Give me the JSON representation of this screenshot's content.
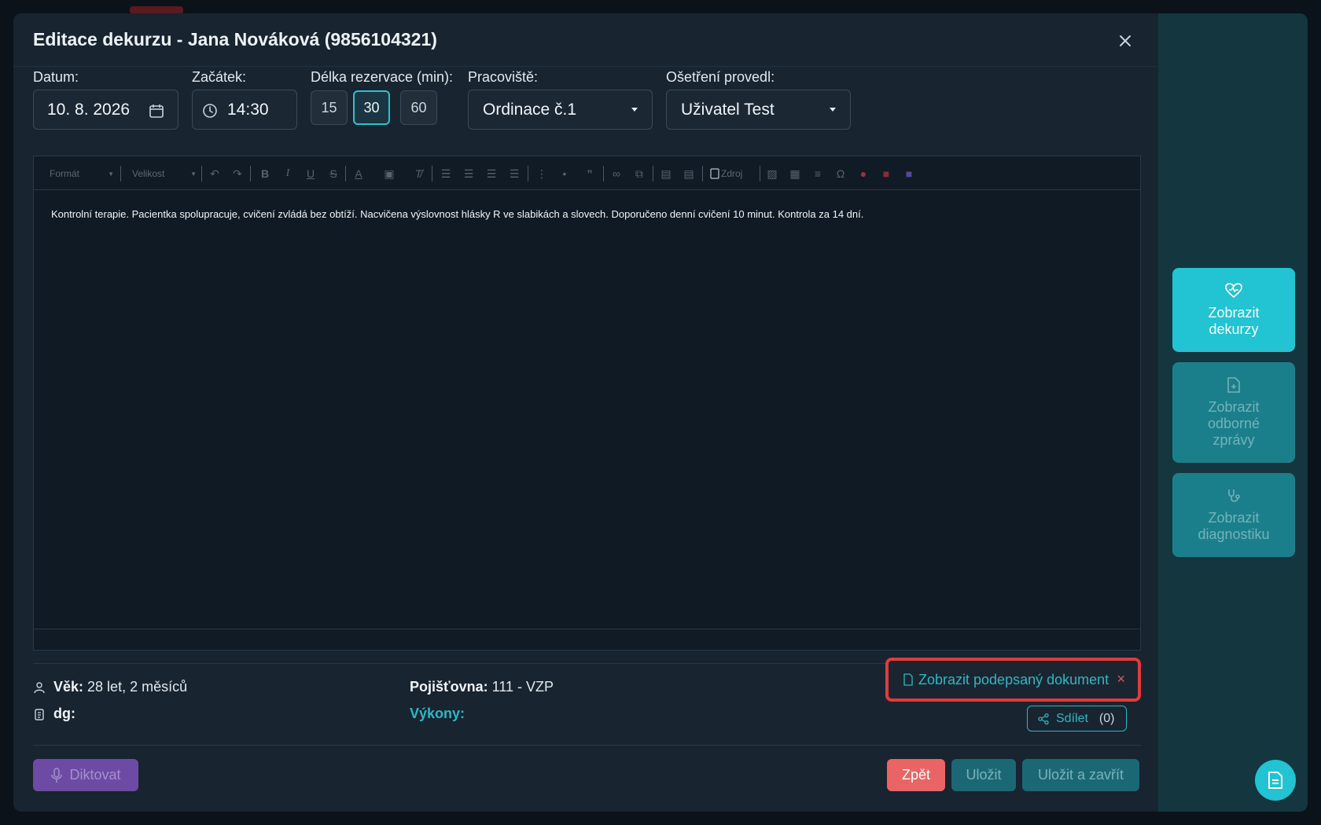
{
  "dialog": {
    "title": "Editace dekurzu - Jana Nováková (9856104321)"
  },
  "form": {
    "date_label": "Datum:",
    "date_value": "10. 8. 2026",
    "start_label": "Začátek:",
    "start_value": "14:30",
    "duration_label": "Délka rezervace (min):",
    "durations": [
      "15",
      "30",
      "60"
    ],
    "duration_selected": "30",
    "workplace_label": "Pracoviště:",
    "workplace_value": "Ordinace č.1",
    "performer_label": "Ošetření provedl:",
    "performer_value": "Uživatel Test"
  },
  "editor": {
    "toolbar": {
      "format_label": "Formát",
      "size_label": "Velikost",
      "source_label": "Zdroj"
    },
    "content": "Kontrolní terapie. Pacientka spolupracuje, cvičení zvládá bez obtíží. Nacvičena výslovnost hlásky R ve slabikách a slovech. Doporučeno denní cvičení 10 minut. Kontrola za 14 dní."
  },
  "patient_info": {
    "age_label": "Věk:",
    "age_value": "28 let, 2 měsíců",
    "dg_label": "dg:",
    "insurer_label": "Pojišťovna:",
    "insurer_value": "111 - VZP",
    "vykony_label": "Výkony:"
  },
  "signed_document": {
    "label": "Zobrazit podepsaný dokument",
    "close_symbol": "×"
  },
  "share": {
    "label": "Sdílet",
    "count": "(0)"
  },
  "actions": {
    "dictate": "Diktovat",
    "back": "Zpět",
    "save": "Uložit",
    "save_close": "Uložit a zavřít"
  },
  "side_panel": {
    "cards": [
      {
        "line1": "Zobrazit",
        "line2": "dekurzy",
        "line3": "",
        "icon": "heart-pulse-icon",
        "active": true
      },
      {
        "line1": "Zobrazit",
        "line2": "odborné",
        "line3": "zprávy",
        "icon": "document-plus-icon",
        "active": false
      },
      {
        "line1": "Zobrazit",
        "line2": "diagnostiku",
        "line3": "",
        "icon": "stethoscope-icon",
        "active": false
      }
    ]
  },
  "colors": {
    "accent": "#22c3d2",
    "danger": "#e96565",
    "highlight_border": "#e23b3b",
    "dialog_bg": "#182430"
  }
}
